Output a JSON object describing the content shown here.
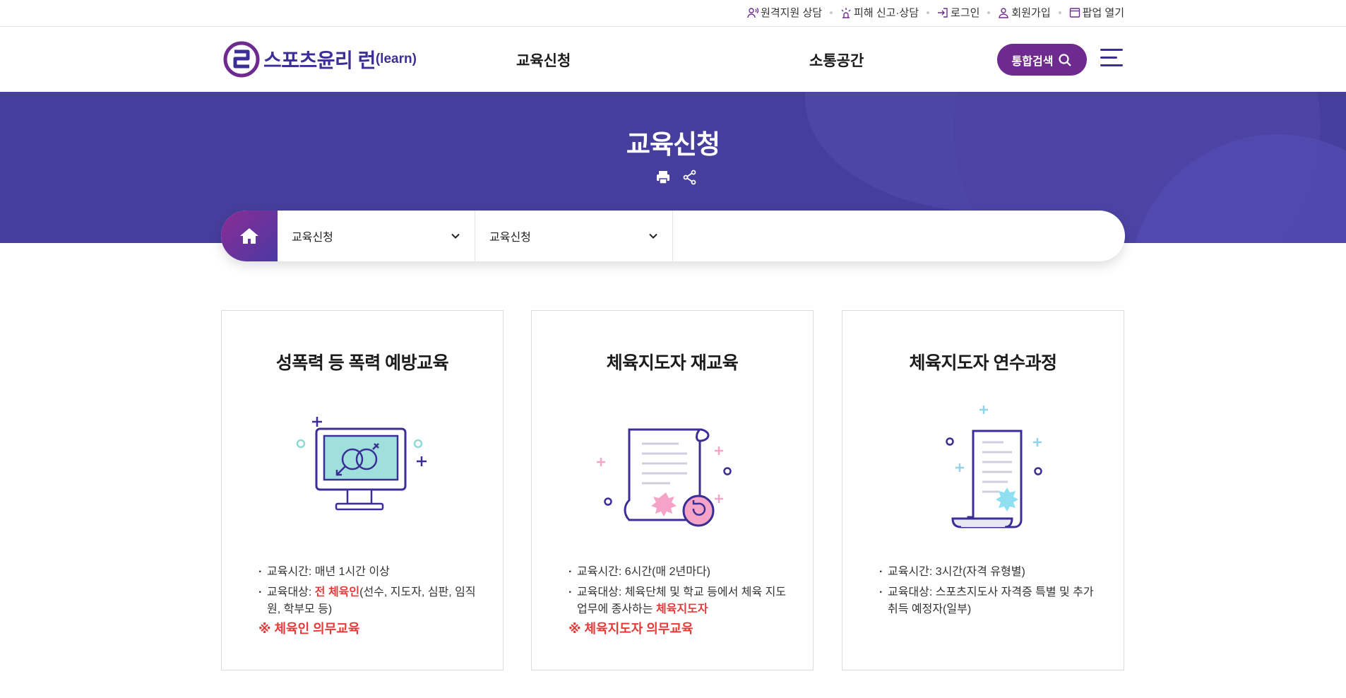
{
  "utility_links": [
    {
      "label": "원격지원 상담",
      "icon": "remote-support-icon"
    },
    {
      "label": "피해 신고·상담",
      "icon": "report-icon"
    },
    {
      "label": "로그인",
      "icon": "login-icon"
    },
    {
      "label": "회원가입",
      "icon": "user-icon"
    },
    {
      "label": "팝업 열기",
      "icon": "popup-icon"
    }
  ],
  "header": {
    "logo_text": "스포츠윤리 런",
    "logo_sub": "(learn)",
    "nav": [
      "교육신청",
      "소통공간"
    ],
    "search_label": "통합검색"
  },
  "hero": {
    "title": "교육신청"
  },
  "location": {
    "depth1": "교육신청",
    "depth2": "교육신청"
  },
  "cards": [
    {
      "title": "성폭력 등 폭력 예방교육",
      "time_text": "교육시간: 매년 1시간 이상",
      "target_prefix": "교육대상: ",
      "target_highlight": "전 체육인",
      "target_rest": "(선수, 지도자, 심판, 임직원, 학부모 등)",
      "note": "※ 체육인 의무교육"
    },
    {
      "title": "체육지도자 재교육",
      "time_text": "교육시간: 6시간(매 2년마다)",
      "target_prefix": "교육대상: 체육단체 및 학교 등에서 체육 지도 업무에 종사하는 ",
      "target_highlight": "체육지도자",
      "note": "※ 체육지도자 의무교육"
    },
    {
      "title": "체육지도자 연수과정",
      "time_text": "교육시간: 3시간(자격 유형별)",
      "target_text": "교육대상: 스포츠지도사 자격증 특별 및 추가 취득 예정자(일부)"
    }
  ],
  "colors": {
    "brand_purple": "#6f2a8f",
    "brand_indigo": "#3b2f97",
    "hero_bg": "#463e9c",
    "highlight_red": "#e53a3a"
  }
}
